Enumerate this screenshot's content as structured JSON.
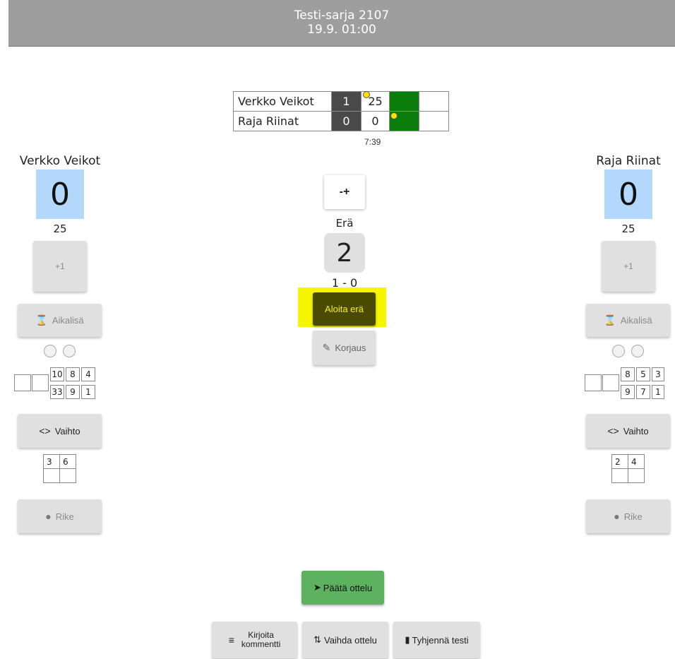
{
  "header": {
    "title": "Testi-sarja 2107",
    "subtitle": "19.9. 01:00"
  },
  "scoreboard": {
    "rows": [
      {
        "team": "Verkko Veikot",
        "sets": "1",
        "points": "25"
      },
      {
        "team": "Raja Riinat",
        "sets": "0",
        "points": "0"
      }
    ],
    "time": "7:39"
  },
  "left_team": {
    "name": "Verkko Veikot",
    "score": "0",
    "points": "25",
    "plus_label": "+1",
    "timeout_label": "Aikalisä",
    "swap_label": "Vaihto",
    "foul_label": "Rike",
    "rotation": {
      "top": [
        "10",
        "8",
        "4"
      ],
      "bottom": [
        "33",
        "9",
        "1"
      ]
    },
    "bench": [
      "3",
      "6",
      "",
      ""
    ]
  },
  "right_team": {
    "name": "Raja Riinat",
    "score": "0",
    "points": "25",
    "plus_label": "+1",
    "timeout_label": "Aikalisä",
    "swap_label": "Vaihto",
    "foul_label": "Rike",
    "rotation": {
      "top": [
        "8",
        "5",
        "3"
      ],
      "bottom": [
        "9",
        "7",
        "1"
      ]
    },
    "bench": [
      "2",
      "4",
      "",
      ""
    ]
  },
  "center": {
    "swap_sides_icon": "-+",
    "set_label": "Erä",
    "set_number": "2",
    "set_score": "1 - 0",
    "start_set_label": "Aloita erä",
    "correction_label": "Korjaus"
  },
  "footer": {
    "end_match_label": "Päätä ottelu",
    "comment_label_line1": "Kirjoita",
    "comment_label_line2": "kommentti",
    "change_match_label": "Vaihda ottelu",
    "clear_test_label": "Tyhjennä testi"
  },
  "colors": {
    "header_bg": "#9e9e9e",
    "score_bg": "#b3d8fb",
    "green": "#0a7d0a",
    "highlight": "#f6f600",
    "end_button": "#5cb25f"
  }
}
